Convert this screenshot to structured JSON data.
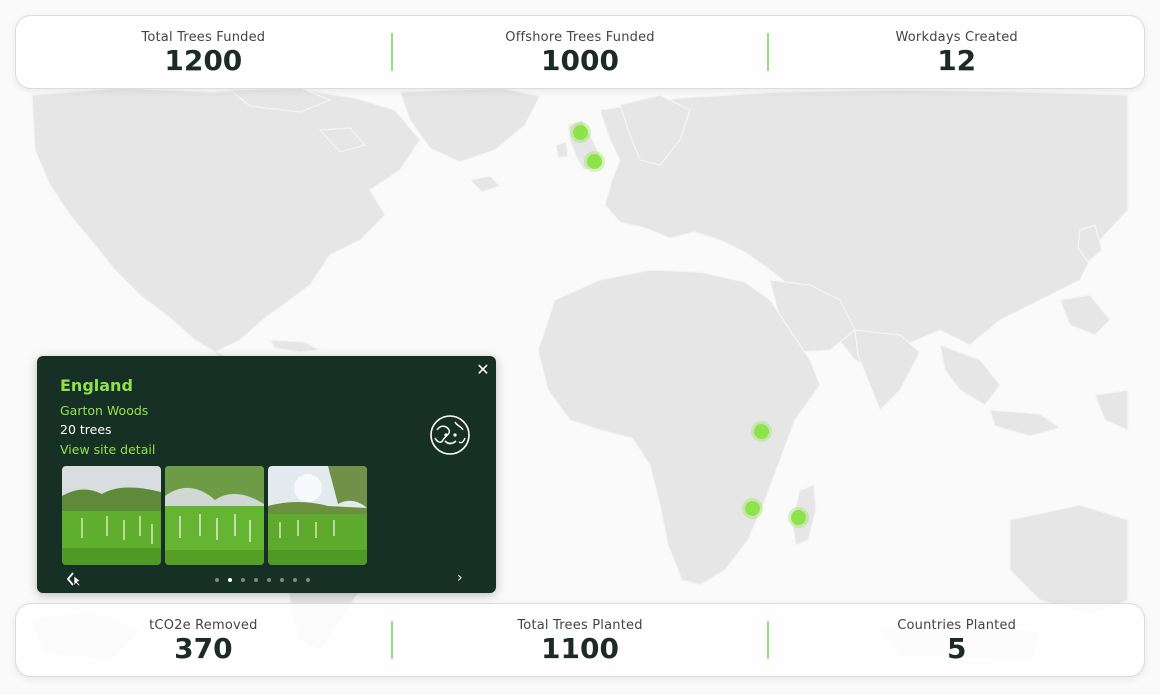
{
  "colors": {
    "accent_green": "#8fe34a",
    "panel_bg": "#173026",
    "map_land": "#e5e5e5",
    "text_dark": "#1c2b25"
  },
  "stats_top": [
    {
      "label": "Total Trees Funded",
      "value": "1200"
    },
    {
      "label": "Offshore Trees Funded",
      "value": "1000"
    },
    {
      "label": "Workdays Created",
      "value": "12"
    }
  ],
  "stats_bottom": [
    {
      "label": "tCO2e Removed",
      "value": "370"
    },
    {
      "label": "Total Trees Planted",
      "value": "1100"
    },
    {
      "label": "Countries Planted",
      "value": "5"
    }
  ],
  "popup": {
    "title": "England",
    "site": "Garton Woods",
    "trees": "20 trees",
    "link": "View site detail",
    "close_icon": "close-icon",
    "globe_icon": "globe-icon",
    "photo_count": 8,
    "active_photo": 2
  }
}
